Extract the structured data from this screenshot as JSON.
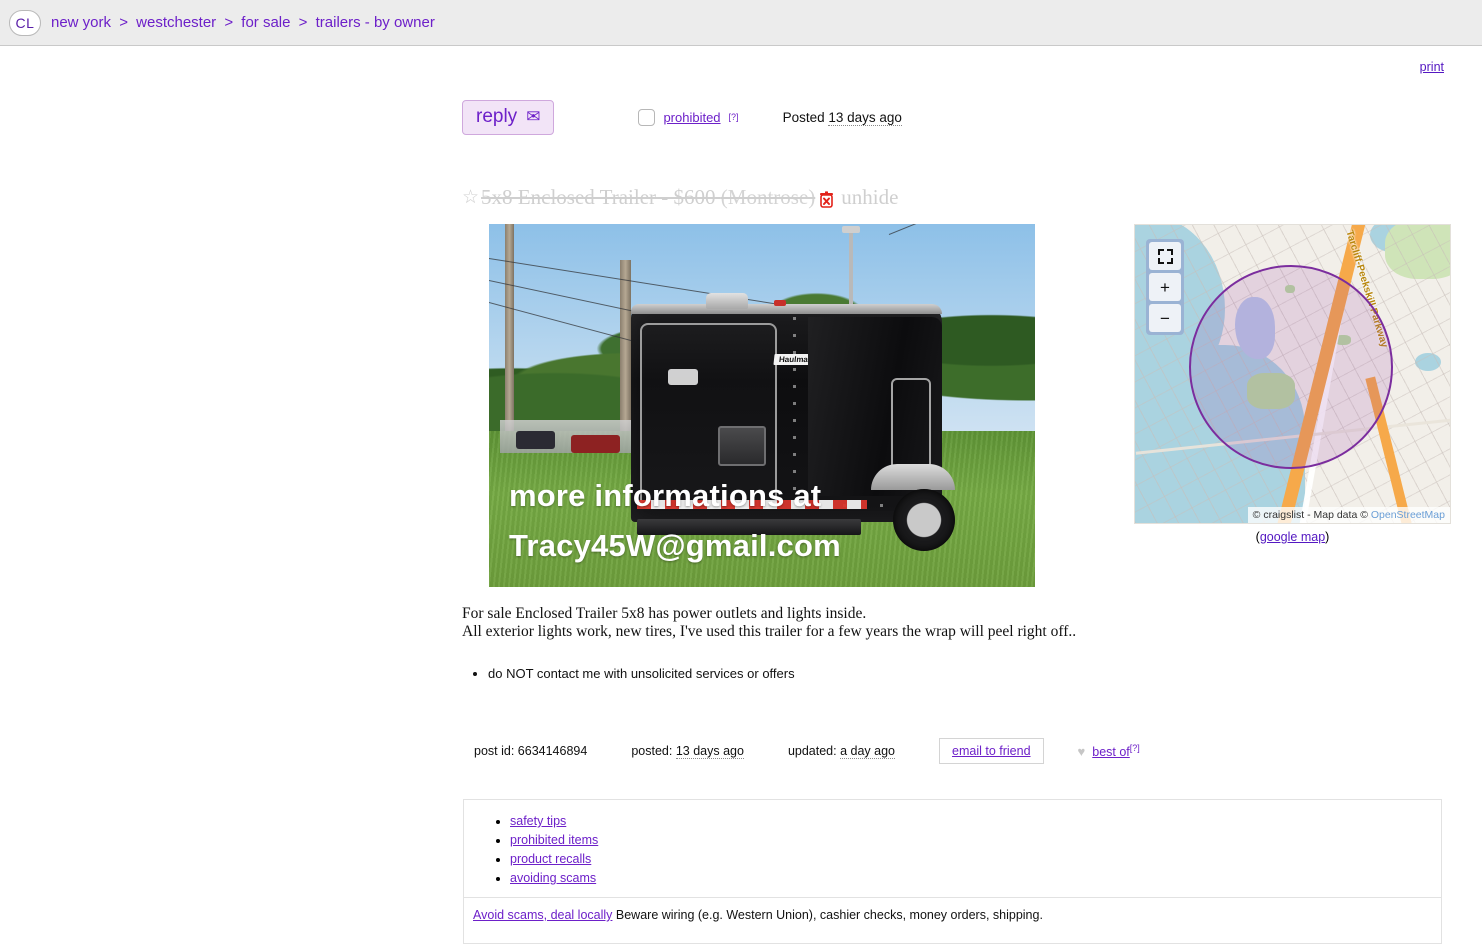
{
  "site": {
    "logo": "CL",
    "breadcrumbs": [
      {
        "label": "new york"
      },
      {
        "label": "westchester"
      },
      {
        "label": "for sale"
      },
      {
        "label": "trailers - by owner"
      }
    ],
    "separator": ">"
  },
  "toolbar": {
    "reply_label": "reply",
    "reply_icon": "envelope-icon",
    "prohibited_label": "prohibited",
    "prohibited_help": "[?]",
    "posted_prefix": "Posted",
    "posted_value": "13 days ago",
    "print_label": "print"
  },
  "posting": {
    "star_icon": "star-icon",
    "title": "5x8 Enclosed Trailer - $600",
    "location": "(Montrose)",
    "unhide_label": "unhide",
    "unhide_icon": "trash-x-icon",
    "is_hidden": true
  },
  "photo": {
    "alt": "black enclosed cargo trailer parked on grass",
    "watermark_line1": "more informations at",
    "watermark_line2": "Tracy45W@gmail.com",
    "brand_label": "Haulmark"
  },
  "map": {
    "fullscreen_icon": "fullscreen-icon",
    "zoom_in_label": "+",
    "zoom_out_label": "−",
    "highway_label": "Tarcliff-Peekskill Parkway",
    "attribution_prefix": "© craigslist - Map data © ",
    "attribution_link": "OpenStreetMap",
    "google_map_open": "(",
    "google_map_label": "google map",
    "google_map_close": ")"
  },
  "body": {
    "line1": "For sale Enclosed Trailer 5x8 has power outlets and lights inside.",
    "line2": "All exterior lights work, new tires, I've used this trailer for a few years the wrap will peel right off.."
  },
  "notices": [
    "do NOT contact me with unsolicited services or offers"
  ],
  "postinfo": {
    "post_id_label": "post id:",
    "post_id_value": "6634146894",
    "posted_label": "posted:",
    "posted_value": "13 days ago",
    "updated_label": "updated:",
    "updated_value": "a day ago",
    "email_friend_label": "email to friend",
    "heart_icon": "heart-icon",
    "best_of_label": "best of",
    "best_of_help": "[?]"
  },
  "footer": {
    "links": [
      "safety tips",
      "prohibited items",
      "product recalls",
      "avoiding scams"
    ],
    "warning_link": "Avoid scams, deal locally",
    "warning_text": " Beware wiring (e.g. Western Union), cashier checks, money orders, shipping."
  },
  "colors": {
    "accent_purple": "#6d20c9",
    "header_bg": "#ececec",
    "hidden_gray": "#cfcfcf",
    "map_circle": "#7b2d9e",
    "highway_orange": "#f6a94a"
  }
}
